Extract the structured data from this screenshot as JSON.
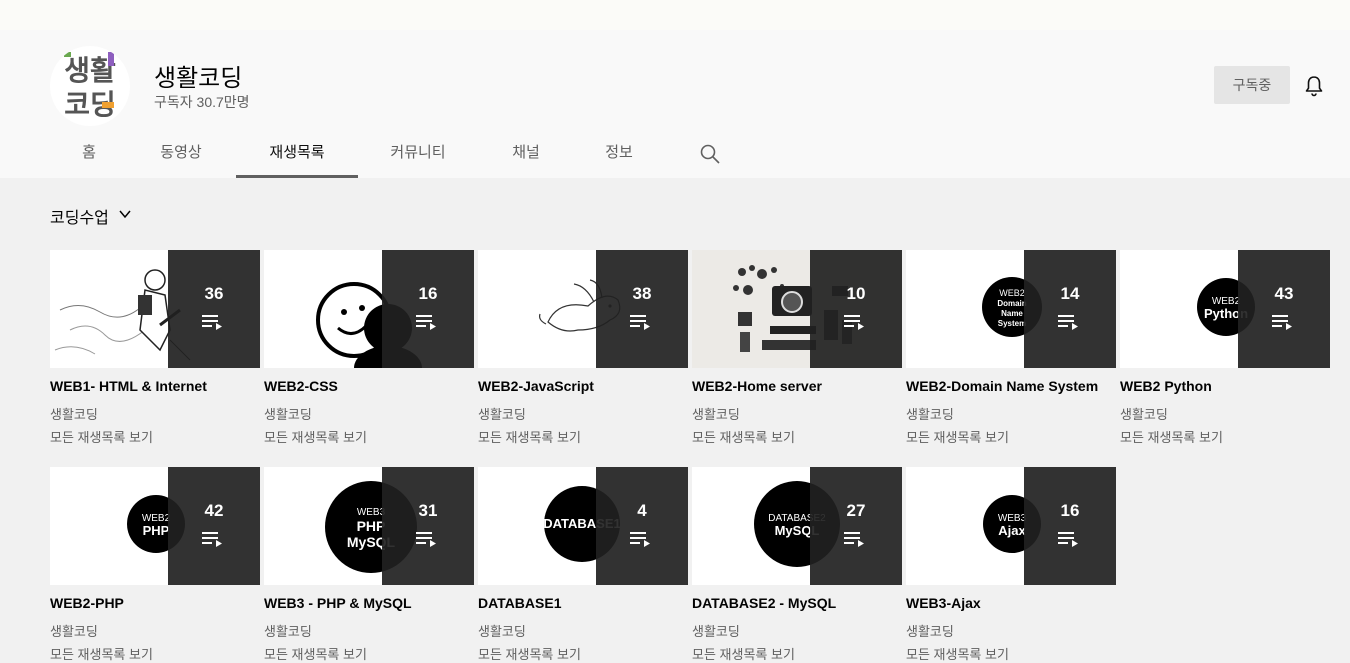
{
  "channel": {
    "title": "생활코딩",
    "subscribers": "구독자 30.7만명",
    "subscribe_label": "구독중",
    "logo_text": [
      "생활",
      "코딩"
    ]
  },
  "tabs": [
    {
      "label": "홈"
    },
    {
      "label": "동영상"
    },
    {
      "label": "재생목록",
      "active": true
    },
    {
      "label": "커뮤니티"
    },
    {
      "label": "채널"
    },
    {
      "label": "정보"
    }
  ],
  "section": {
    "title": "코딩수업"
  },
  "playlists": [
    {
      "title": "WEB1- HTML & Internet",
      "channel": "생활코딩",
      "view_all": "모든 재생목록 보기",
      "count": "36",
      "thumb": "sketch"
    },
    {
      "title": "WEB2-CSS",
      "channel": "생활코딩",
      "view_all": "모든 재생목록 보기",
      "count": "16",
      "thumb": "face"
    },
    {
      "title": "WEB2-JavaScript",
      "channel": "생활코딩",
      "view_all": "모든 재생목록 보기",
      "count": "38",
      "thumb": "rabbit"
    },
    {
      "title": "WEB2-Home server",
      "channel": "생활코딩",
      "view_all": "모든 재생목록 보기",
      "count": "10",
      "thumb": "gear"
    },
    {
      "title": "WEB2-Domain Name System",
      "channel": "생활코딩",
      "view_all": "모든 재생목록 보기",
      "count": "14",
      "thumb": "circle",
      "circle_lines": [
        "WEB2",
        "Domain",
        "Name",
        "System"
      ]
    },
    {
      "title": "WEB2 Python",
      "channel": "생활코딩",
      "view_all": "모든 재생목록 보기",
      "count": "43",
      "thumb": "circle",
      "circle_lines": [
        "WEB2",
        "Python"
      ]
    },
    {
      "title": "WEB2-PHP",
      "channel": "생활코딩",
      "view_all": "모든 재생목록 보기",
      "count": "42",
      "thumb": "circle",
      "circle_lines": [
        "WEB2",
        "PHP"
      ]
    },
    {
      "title": "WEB3 - PHP & MySQL",
      "channel": "생활코딩",
      "view_all": "모든 재생목록 보기",
      "count": "31",
      "thumb": "circle-big",
      "circle_lines": [
        "WEB3",
        "PHP",
        "MySQL"
      ]
    },
    {
      "title": "DATABASE1",
      "channel": "생활코딩",
      "view_all": "모든 재생목록 보기",
      "count": "4",
      "thumb": "circle",
      "circle_lines": [
        "DATABASE1"
      ]
    },
    {
      "title": "DATABASE2 - MySQL",
      "channel": "생활코딩",
      "view_all": "모든 재생목록 보기",
      "count": "27",
      "thumb": "circle",
      "circle_lines": [
        "DATABASE2",
        "MySQL"
      ]
    },
    {
      "title": "WEB3-Ajax",
      "channel": "생활코딩",
      "view_all": "모든 재생목록 보기",
      "count": "16",
      "thumb": "circle",
      "circle_lines": [
        "WEB3",
        "Ajax"
      ]
    }
  ],
  "icons": {
    "bell": "bell-icon",
    "search": "search-icon",
    "chevron": "chevron-down-icon",
    "playlist": "playlist-play-icon"
  },
  "colors": {
    "overlay": "#212121",
    "logo_green": "#6aa84f",
    "logo_purple": "#8e5fbf",
    "logo_orange": "#f0a030"
  }
}
